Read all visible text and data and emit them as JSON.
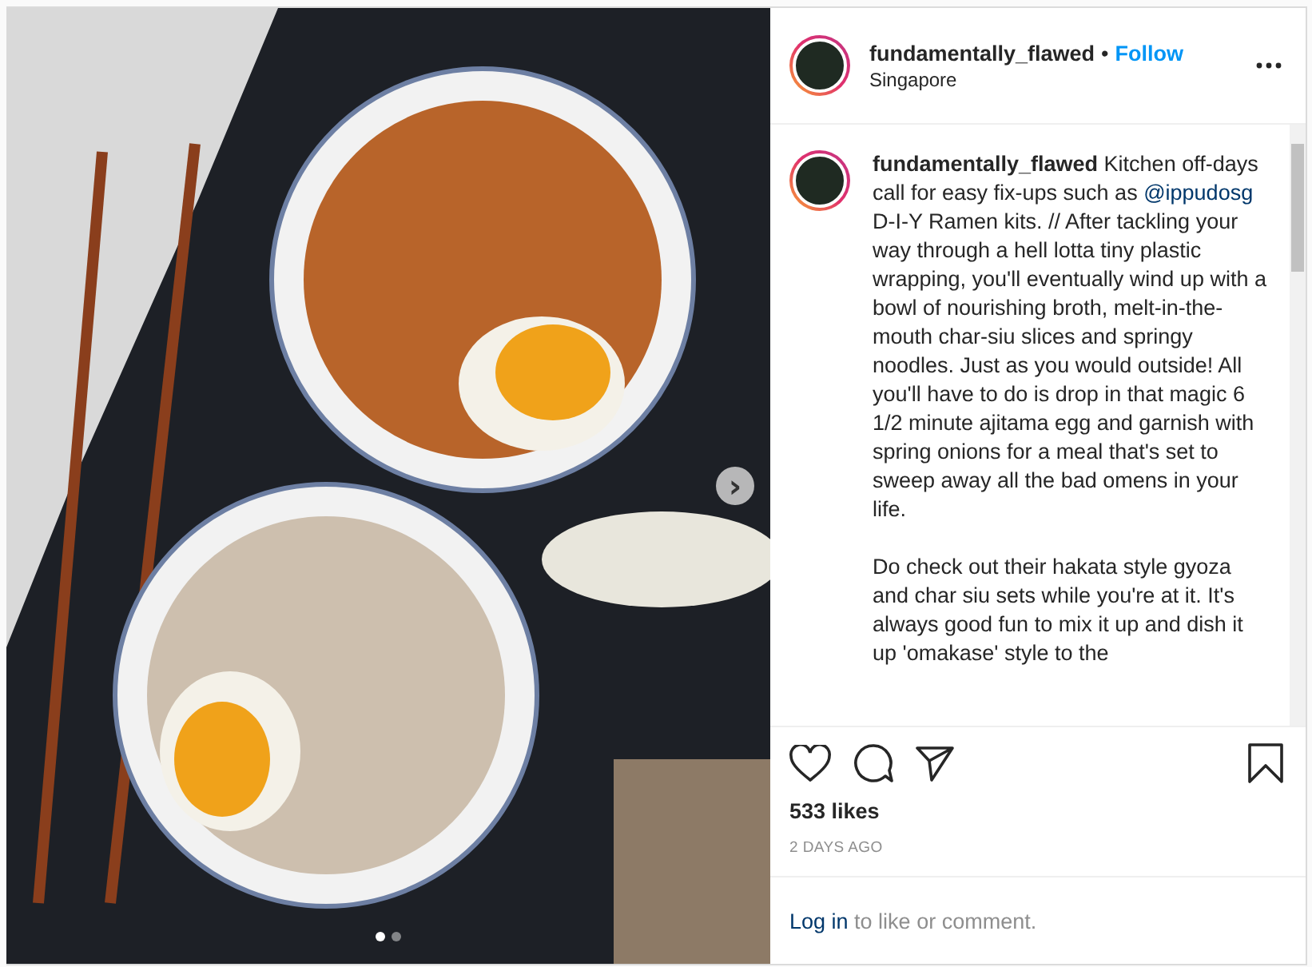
{
  "photo": {
    "next_button": "›",
    "dots": [
      {
        "selected": true
      },
      {
        "selected": false
      }
    ]
  },
  "header": {
    "username": "fundamentally_flawed",
    "separator": "•",
    "follow": "Follow",
    "location": "Singapore"
  },
  "caption": {
    "username": "fundamentally_flawed",
    "text_before_mention": "Kitchen off-days call for easy fix-ups such as",
    "mention": "@ippudosg",
    "text_after_mention": "D-I-Y Ramen kits. // After tackling your way through a hell lotta tiny plastic wrapping, you'll eventually wind up with a bowl of nourishing broth, melt-in-the-mouth char-siu slices and springy noodles. Just as you would outside! All you'll have to do is drop in that magic 6 1/2 minute ajitama egg and garnish with spring onions for a meal that's set to sweep away all the bad omens in your life.",
    "paragraph_2": "Do check out their hakata style gyoza and char siu sets while you're at it. It's always good fun to mix it up and dish it up 'omakase' style to the"
  },
  "likes": "533 likes",
  "time": "2 DAYS AGO",
  "login": {
    "link": "Log in",
    "text": "to like or comment."
  }
}
